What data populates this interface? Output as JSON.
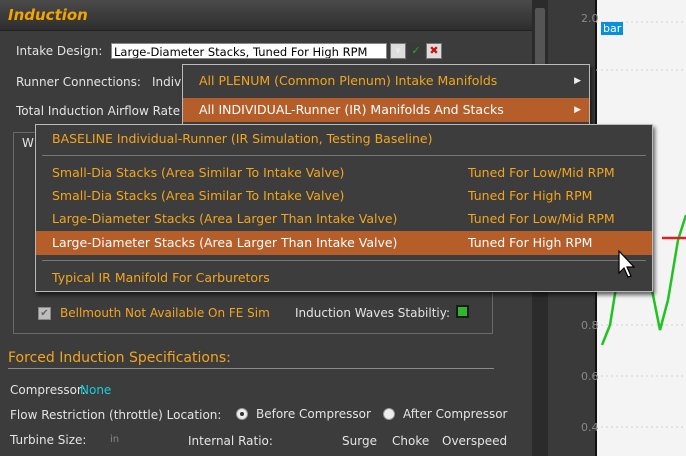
{
  "header": {
    "title": "Induction"
  },
  "intake": {
    "label": "Intake Design:",
    "value": "Large-Diameter Stacks, Tuned For High RPM",
    "dropdown_icon": "dropdown-icon",
    "accept_icon": "check-icon",
    "cancel_icon": "close-icon",
    "accept_color": "#1bb31b",
    "cancel_color": "#cc1010"
  },
  "runner": {
    "label": "Runner Connections:",
    "value": "Indiv"
  },
  "airflow": {
    "label": "Total Induction Airflow Rate"
  },
  "group_letter": "W",
  "menu_top": {
    "items": [
      {
        "label": "All PLENUM (Common Plenum) Intake Manifolds",
        "arrow": "▶"
      },
      {
        "label": "All INDIVIDUAL-Runner (IR) Manifolds And Stacks",
        "arrow": "▶"
      }
    ]
  },
  "submenu": {
    "items": [
      {
        "label": "BASELINE Individual-Runner  (IR Simulation, Testing Baseline)",
        "right": ""
      },
      {
        "label": "Small-Dia Stacks (Area Similar To Intake Valve)",
        "right": "Tuned For Low/Mid RPM"
      },
      {
        "label": "Small-Dia Stacks (Area Similar To Intake Valve)",
        "right": "Tuned For High RPM"
      },
      {
        "label": "Large-Diameter Stacks (Area Larger Than Intake Valve)",
        "right": "Tuned For Low/Mid RPM"
      },
      {
        "label": "Large-Diameter Stacks (Area Larger Than Intake Valve)",
        "right": "Tuned For High RPM"
      },
      {
        "label": "Typical IR Manifold For Carburetors",
        "right": ""
      }
    ]
  },
  "bellmouth": {
    "label": "Bellmouth Not Available On FE Sim",
    "check": "✔"
  },
  "waves": {
    "label": "Induction Waves Stabiltiy:",
    "indicator_color": "#2fb52f"
  },
  "forced": {
    "title": "Forced Induction Specifications:",
    "compressor_label": "Compressor:",
    "compressor_value": "None",
    "flow_label": "Flow Restriction (throttle) Location:",
    "opt_before": "Before Compressor",
    "opt_after": "After Compressor",
    "turbine_label": "Turbine Size:",
    "turbine_unit": "in",
    "internal_label": "Internal Ratio:",
    "surge": "Surge",
    "choke": "Choke",
    "overspeed": "Overspeed"
  },
  "chart_data": {
    "type": "line",
    "yticks": [
      "2.0",
      "0.8",
      "0.6",
      "0.4"
    ],
    "tag": "bar",
    "series_colors": [
      "#0a8fe0",
      "#21c321",
      "#e02020"
    ]
  }
}
